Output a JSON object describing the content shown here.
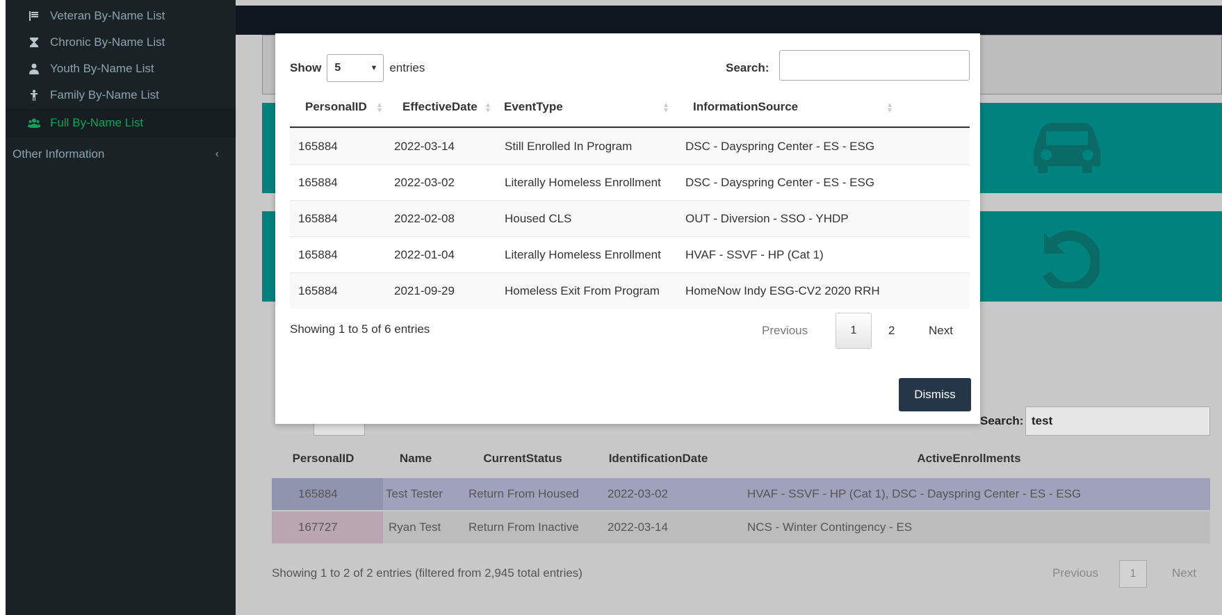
{
  "sidebar": {
    "items": [
      {
        "label": "Veteran By-Name List",
        "icon": "flag-icon"
      },
      {
        "label": "Chronic By-Name List",
        "icon": "hourglass-icon"
      },
      {
        "label": "Youth By-Name List",
        "icon": "user-icon"
      },
      {
        "label": "Family By-Name List",
        "icon": "child-icon"
      },
      {
        "label": "Full By-Name List",
        "icon": "users-icon"
      }
    ],
    "other": "Other Information",
    "other_chevron": "‹"
  },
  "background_table": {
    "search_label": "Search:",
    "search_value": "test",
    "headers": [
      "PersonalID",
      "Name",
      "CurrentStatus",
      "IdentificationDate",
      "ActiveEnrollments"
    ],
    "rows": [
      {
        "id": "165884",
        "name": "Test Tester",
        "status": "Return From Housed",
        "date": "2022-03-02",
        "enrollments": "HVAF - SSVF - HP (Cat 1), DSC - Dayspring Center - ES - ESG"
      },
      {
        "id": "167727",
        "name": "Ryan Test",
        "status": "Return From Inactive",
        "date": "2022-03-14",
        "enrollments": "NCS - Winter Contingency - ES"
      }
    ],
    "info": "Showing 1 to 2 of 2 entries (filtered from 2,945 total entries)",
    "pagination": {
      "previous": "Previous",
      "page": "1",
      "next": "Next"
    }
  },
  "modal": {
    "show_label": "Show",
    "entries_value": "5",
    "entries_label": "entries",
    "search_label": "Search:",
    "search_value": "",
    "headers": [
      "PersonalID",
      "EffectiveDate",
      "EventType",
      "InformationSource"
    ],
    "rows": [
      {
        "id": "165884",
        "date": "2022-03-14",
        "event": "Still Enrolled In Program",
        "source": "DSC - Dayspring Center - ES - ESG"
      },
      {
        "id": "165884",
        "date": "2022-03-02",
        "event": "Literally Homeless Enrollment",
        "source": "DSC - Dayspring Center - ES - ESG"
      },
      {
        "id": "165884",
        "date": "2022-02-08",
        "event": "Housed CLS",
        "source": "OUT - Diversion - SSO - YHDP"
      },
      {
        "id": "165884",
        "date": "2022-01-04",
        "event": "Literally Homeless Enrollment",
        "source": "HVAF - SSVF - HP (Cat 1)"
      },
      {
        "id": "165884",
        "date": "2021-09-29",
        "event": "Homeless Exit From Program",
        "source": "HomeNow Indy ESG-CV2 2020 RRH"
      }
    ],
    "info": "Showing 1 to 5 of 6 entries",
    "pagination": {
      "previous": "Previous",
      "page1": "1",
      "page2": "2",
      "next": "Next"
    },
    "dismiss_label": "Dismiss"
  },
  "colors": {
    "sidebar_bg": "#1a2226",
    "active_green": "#00a65a",
    "teal": "#00827e",
    "dismiss_bg": "#253648"
  }
}
